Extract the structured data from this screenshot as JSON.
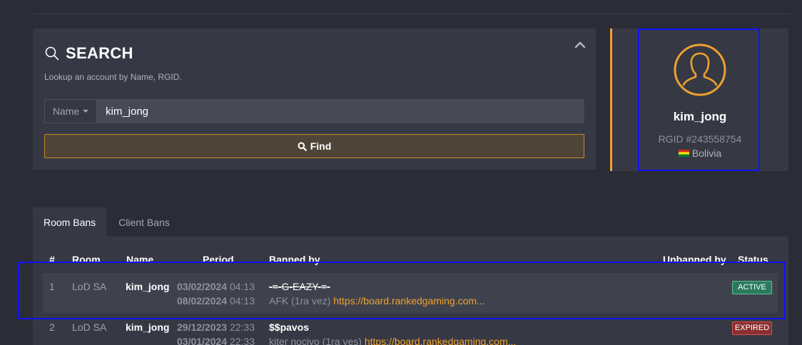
{
  "search": {
    "title": "SEARCH",
    "subtitle": "Lookup an account by Name, RGID.",
    "field_type": "Name",
    "query_value": "kim_jong",
    "find_label": "Find"
  },
  "profile": {
    "name": "kim_jong",
    "rgid": "RGID #243558754",
    "country": "Bolivia"
  },
  "tabs": [
    {
      "label": "Room Bans",
      "active": true
    },
    {
      "label": "Client Bans",
      "active": false
    }
  ],
  "table": {
    "headers": {
      "num": "#",
      "room": "Room",
      "name": "Name",
      "period": "Period",
      "banned_by": "Banned by",
      "unbanned_by": "Unbanned by",
      "status": "Status"
    },
    "rows": [
      {
        "num": "1",
        "room": "LoD SA",
        "name": "kim_jong",
        "start_date": "03/02/2024",
        "start_time": "04:13",
        "end_date": "08/02/2024",
        "end_time": "04:13",
        "banned_by": "-=-G-EAZY-=-",
        "reason": "AFK (1ra vez)",
        "link": "https://board.rankedgaming.com...",
        "status": "ACTIVE"
      },
      {
        "num": "2",
        "room": "LoD SA",
        "name": "kim_jong",
        "start_date": "29/12/2023",
        "start_time": "22:33",
        "end_date": "03/01/2024",
        "end_time": "22:33",
        "banned_by": "$$pavos",
        "reason": "kiter nocivo (1ra ves)",
        "link": "https://board.rankedgaming.com...",
        "status": "EXPIRED"
      }
    ]
  },
  "colors": {
    "accent": "#f0a22e",
    "background": "#2b2d36",
    "panel": "#363944",
    "active_badge": "#2b7a5d",
    "expired_badge": "#8a3030",
    "highlight_box": "#1010ff"
  }
}
